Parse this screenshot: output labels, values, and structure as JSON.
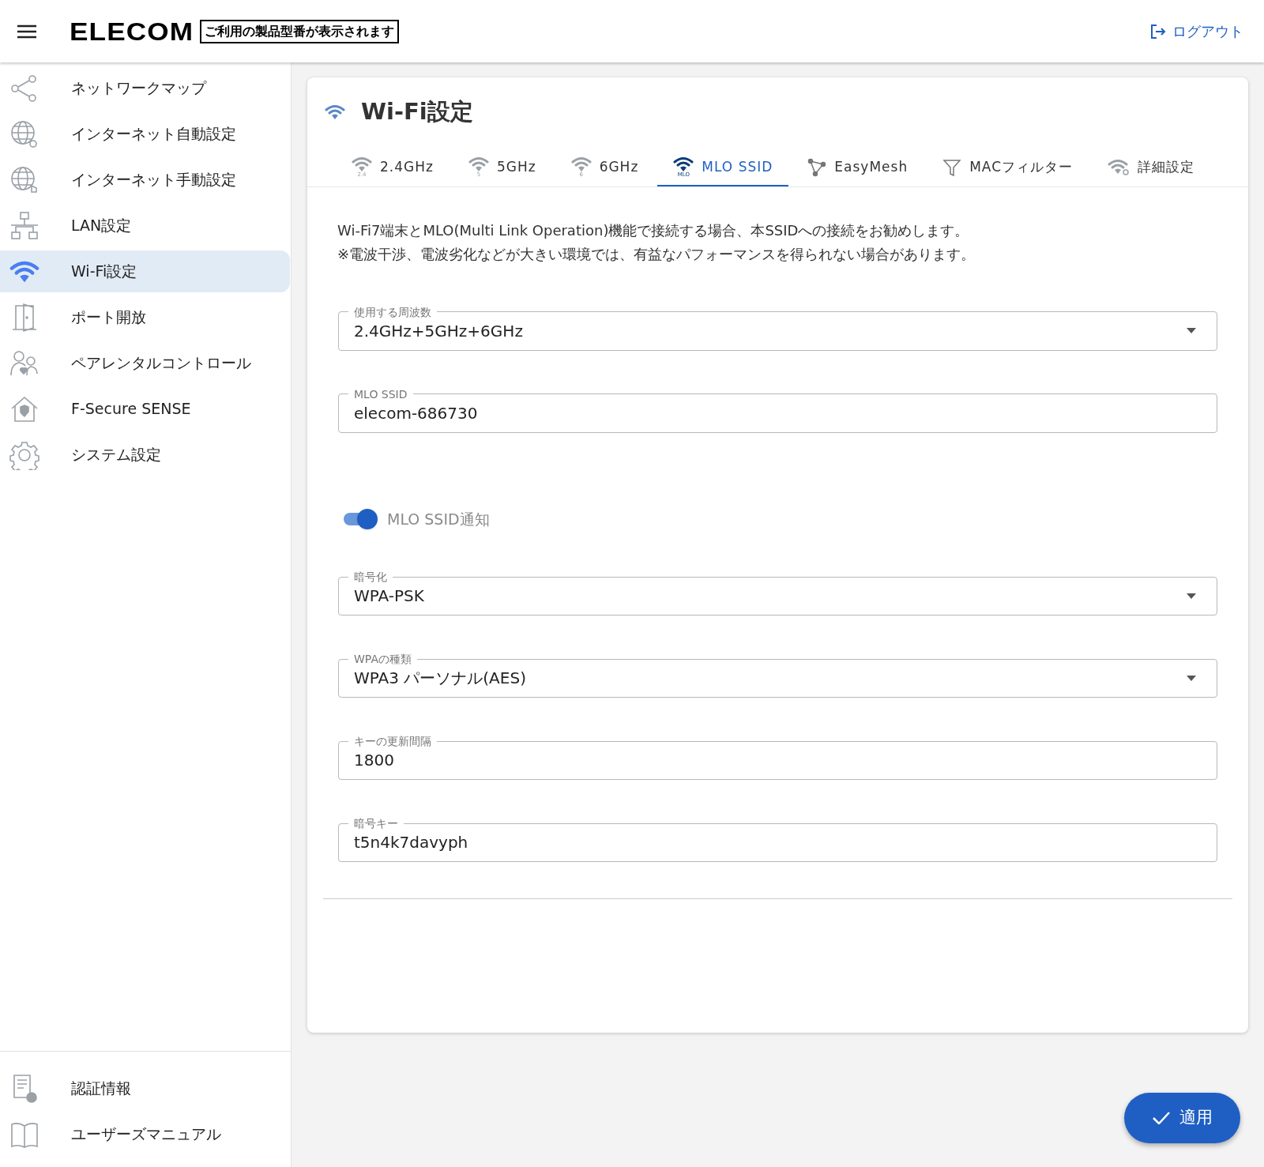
{
  "header": {
    "logo": "ELECOM",
    "model_placeholder": "ご利用の製品型番が表示されます",
    "logout": "ログアウト"
  },
  "sidebar": {
    "items": [
      {
        "label": "ネットワークマップ",
        "selected": false
      },
      {
        "label": "インターネット自動設定",
        "selected": false
      },
      {
        "label": "インターネット手動設定",
        "selected": false
      },
      {
        "label": "LAN設定",
        "selected": false
      },
      {
        "label": "Wi-Fi設定",
        "selected": true
      },
      {
        "label": "ポート開放",
        "selected": false
      },
      {
        "label": "ペアレンタルコントロール",
        "selected": false
      },
      {
        "label": "F-Secure SENSE",
        "selected": false
      },
      {
        "label": "システム設定",
        "selected": false
      }
    ],
    "bottom_items": [
      {
        "label": "認証情報"
      },
      {
        "label": "ユーザーズマニュアル"
      }
    ]
  },
  "page": {
    "title": "Wi-Fi設定",
    "tabs": [
      {
        "label": "2.4GHz",
        "icon_label": "2.4",
        "selected": false
      },
      {
        "label": "5GHz",
        "icon_label": "5",
        "selected": false
      },
      {
        "label": "6GHz",
        "icon_label": "6",
        "selected": false
      },
      {
        "label": "MLO SSID",
        "icon_label": "MLO",
        "selected": true
      },
      {
        "label": "EasyMesh",
        "selected": false
      },
      {
        "label": "MACフィルター",
        "selected": false
      },
      {
        "label": "詳細設定",
        "selected": false
      }
    ],
    "description": [
      "Wi-Fi7端末とMLO(Multi Link Operation)機能で接続する場合、本SSIDへの接続をお勧めします。",
      "※電波干渉、電波劣化などが大きい環境では、有益なパフォーマンスを得られない場合があります。"
    ],
    "fields": [
      {
        "kind": "select",
        "label": "使用する周波数",
        "value": "2.4GHz+5GHz+6GHz"
      },
      {
        "kind": "text",
        "label": "MLO SSID",
        "value": "elecom-686730"
      },
      {
        "kind": "toggle",
        "label": "MLO SSID通知",
        "on": true
      },
      {
        "kind": "select",
        "label": "暗号化",
        "value": "WPA-PSK"
      },
      {
        "kind": "select",
        "label": "WPAの種類",
        "value": "WPA3 パーソナル(AES)"
      },
      {
        "kind": "text",
        "label": "キーの更新間隔",
        "value": "1800"
      },
      {
        "kind": "text",
        "label": "暗号キー",
        "value": "t5n4k7davyph"
      }
    ]
  },
  "apply_button": "適用"
}
